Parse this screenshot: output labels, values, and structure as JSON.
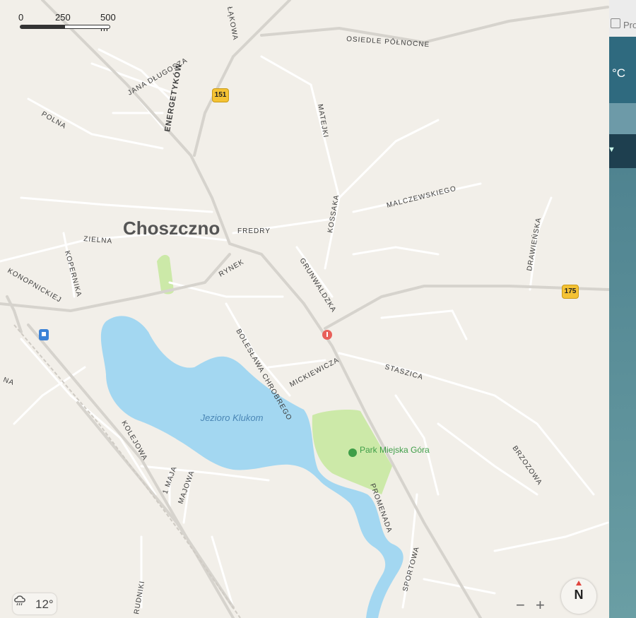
{
  "city": "Choszczno",
  "scale": {
    "zero": "0",
    "mid": "250",
    "end": "500 m"
  },
  "lake": {
    "name": "Jezioro Klukom"
  },
  "park": {
    "name": "Park Miejska Góra"
  },
  "route_shields": [
    "151",
    "175"
  ],
  "streets": {
    "osiedle": "OSIEDLE PÓŁNOCNE",
    "lakowa": "ŁĄKOWA",
    "dlugosza": "JANA DŁUGOSZA",
    "energetykow": "ENERGETYKÓW",
    "polna": "POLNA",
    "matejki": "MATEJKI",
    "malczewskiego": "MALCZEWSKIEGO",
    "kossaka": "KOSSAKA",
    "fredry": "FREDRY",
    "drawienska": "DRAWIEŃSKA",
    "zielna": "ZIELNA",
    "konopnickiej": "KONOPNICKIEJ",
    "kopernika": "KOPERNIKA",
    "rynek": "RYNEK",
    "grunwaldzka": "GRUNWALDZKA",
    "boleslawa": "BOLESŁAWA CHROBREGO",
    "mickiewicza": "MICKIEWICZA",
    "staszica": "STASZICA",
    "kolejowa": "KOLEJOWA",
    "brzozowa": "BRZOZOWA",
    "maja": "1 MAJA",
    "majowa": "MAJOWA",
    "promenada": "PROMENADA",
    "sportowa": "SPORTOWA",
    "rudniki": "RUDNIKI",
    "na": "NA"
  },
  "weather": {
    "temp": "12°",
    "icon": "rain-cloud-icon"
  },
  "zoom": {
    "minus": "−",
    "plus": "+"
  },
  "compass": {
    "label": "N"
  },
  "side_panel": {
    "pro": "Pro",
    "unit": "°C"
  },
  "colors": {
    "water": "#a3d7f1",
    "park": "#cce9a8",
    "land": "#f2efe9",
    "road": "#ffffff",
    "main_road": "#d6d3cd",
    "shield": "#f4c234"
  }
}
